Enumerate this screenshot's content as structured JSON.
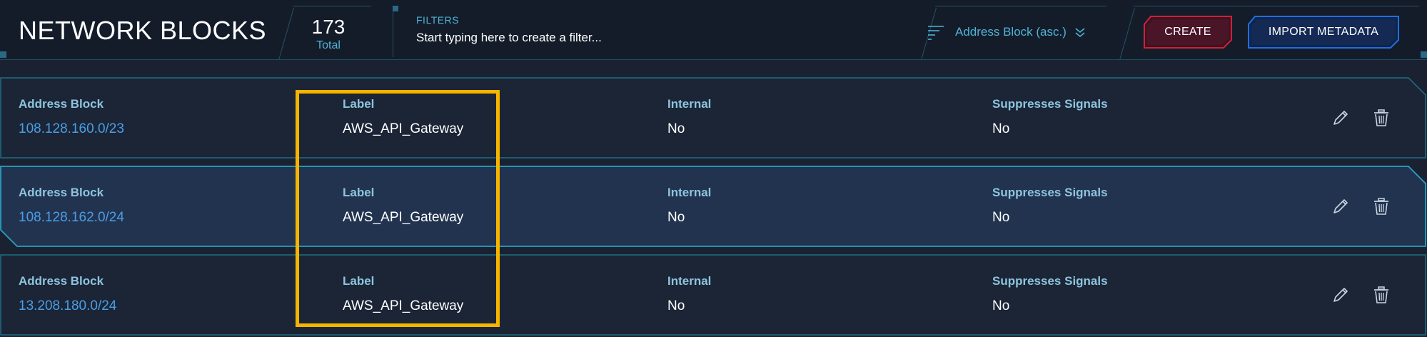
{
  "header": {
    "title": "NETWORK BLOCKS",
    "total_count": "173",
    "total_label": "Total",
    "filters_label": "FILTERS",
    "filter_placeholder": "Start typing here to create a filter...",
    "sort_label": "Address Block (asc.)",
    "sort_icon": "sort-lines-icon",
    "sort_chevron_icon": "double-chevron-down-icon",
    "create_label": "CREATE",
    "import_label": "IMPORT METADATA"
  },
  "columns": [
    "Address Block",
    "Label",
    "Internal",
    "Suppresses Signals"
  ],
  "rows": [
    {
      "address_block": "108.128.160.0/23",
      "label": "AWS_API_Gateway",
      "internal": "No",
      "suppresses_signals": "No",
      "selected": false
    },
    {
      "address_block": "108.128.162.0/24",
      "label": "AWS_API_Gateway",
      "internal": "No",
      "suppresses_signals": "No",
      "selected": true
    },
    {
      "address_block": "13.208.180.0/24",
      "label": "AWS_API_Gateway",
      "internal": "No",
      "suppresses_signals": "No",
      "selected": false
    }
  ],
  "row_actions": [
    "pencil-icon",
    "trash-icon"
  ],
  "colors": {
    "background": "#1a2231",
    "header_bg": "#141c2a",
    "row_bg": "#1b2536",
    "row_selected_bg": "#223350",
    "border_cyan": "#1f6f86",
    "accent_cyan": "#4fb3d6",
    "link_blue": "#4a9ee6",
    "create_red": "#d0203a",
    "import_blue": "#1f6fe0",
    "highlight": "#f7b500"
  }
}
